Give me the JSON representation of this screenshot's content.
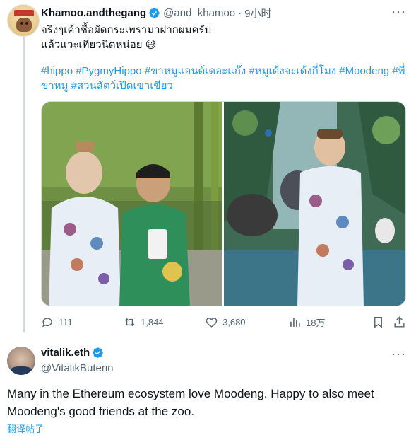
{
  "tweet1": {
    "display_name": "Khamoo.andthegang",
    "handle": "@and_khamoo",
    "separator": "·",
    "time": "9小时",
    "text_line1": "จริงๆเค้าซื้อผัดกระเพรามาฝากผมครับ",
    "text_line2": "แล้วแวะเที่ยวนิดหน่อย 😅",
    "hashtags": "#hippo #PygmyHippo #ขาหมูแอนด์เดอะแก๊ง #หมูเด้งจะเด้งกี่โมง #Moodeng #พี่ขาหมู #สวนสัตว์เปิดเขาเขียว",
    "stats": {
      "replies": "111",
      "reposts": "1,844",
      "likes": "3,680",
      "views": "18万"
    }
  },
  "tweet2": {
    "display_name": "vitalik.eth",
    "handle": "@VitalikButerin",
    "text": "Many in the Ethereum ecosystem love Moodeng. Happy to also meet Moodeng's good friends at the zoo.",
    "translate_label": "翻译帖子"
  },
  "colors": {
    "accent": "#1d9bf0",
    "secondary_text": "#536471",
    "primary_text": "#0f1419",
    "divider": "#cfd9de"
  }
}
